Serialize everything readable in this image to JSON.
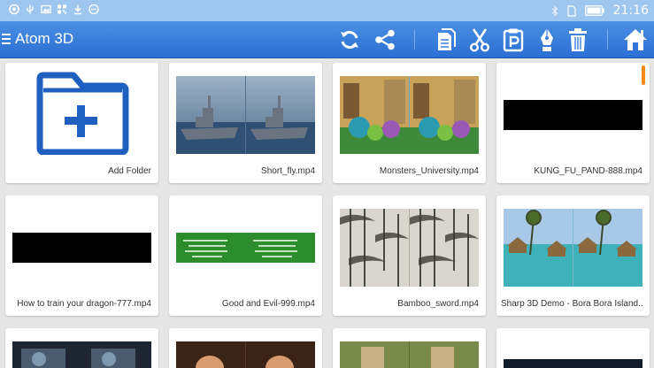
{
  "status_bar": {
    "time": "21:16",
    "left_icons": [
      "chrome-icon",
      "usb-icon",
      "image-icon",
      "qr-icon",
      "download-icon",
      "dots-icon"
    ],
    "right_icons": [
      "bluetooth-icon",
      "sim-icon",
      "battery-icon"
    ]
  },
  "app_bar": {
    "title": "Atom 3D",
    "actions": [
      "refresh-icon",
      "share-icon",
      "copy-icon",
      "cut-icon",
      "paste-icon",
      "rename-icon",
      "delete-icon",
      "home-icon"
    ],
    "color_top": "#4b90e2",
    "color_bottom": "#2a6fd3"
  },
  "add_folder_label": "Add Folder",
  "videos": [
    {
      "name": "Short_fly.mp4",
      "thumb": "warship-sbs"
    },
    {
      "name": "Monsters_University.mp4",
      "thumb": "monsters-sbs"
    },
    {
      "name": "KUNG_FU_PAND-888.mp4",
      "thumb": "black"
    },
    {
      "name": "How to train your dragon-777.mp4",
      "thumb": "black"
    },
    {
      "name": "Good and Evil-999.mp4",
      "thumb": "green-text"
    },
    {
      "name": "Bamboo_sword.mp4",
      "thumb": "bamboo-sbs"
    },
    {
      "name": "Sharp 3D Demo - Bora Bora Island...",
      "thumb": "bora-bora-sbs"
    }
  ],
  "accent_color": "#f28a1b"
}
